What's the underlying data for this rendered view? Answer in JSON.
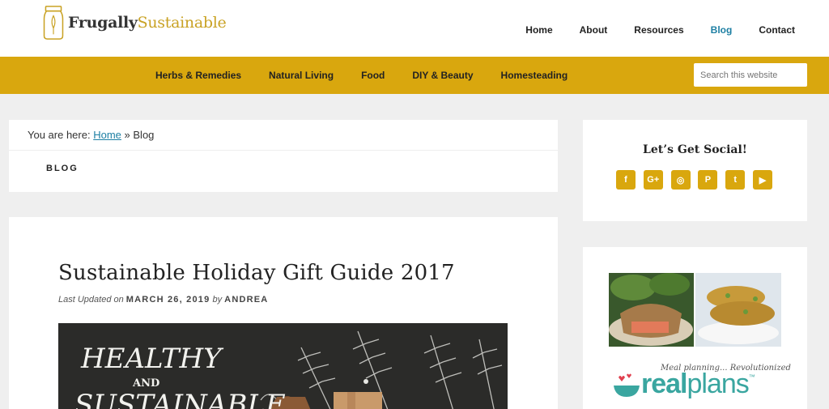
{
  "site": {
    "name_part1": "Frugally",
    "name_part2": "Sustainable"
  },
  "top_nav": [
    "Home",
    "About",
    "Resources",
    "Blog",
    "Contact"
  ],
  "top_nav_active": "Blog",
  "category_nav": [
    "Herbs & Remedies",
    "Natural Living",
    "Food",
    "DIY & Beauty",
    "Homesteading"
  ],
  "search": {
    "placeholder": "Search this website"
  },
  "breadcrumb": {
    "prefix": "You are here:",
    "home": "Home",
    "separator": "»",
    "current": "Blog"
  },
  "archive_title": "BLOG",
  "post": {
    "title": "Sustainable Holiday Gift Guide 2017",
    "updated_label": "Last Updated on",
    "date": "MARCH 26, 2019",
    "by": "by",
    "author": "ANDREA",
    "image_text_line1": "HEALTHY",
    "image_text_line2": "AND",
    "image_text_line3": "SUSTAINABLE"
  },
  "sidebar": {
    "social_title": "Let’s Get Social!",
    "social_icons": [
      "facebook-icon",
      "google-plus-icon",
      "instagram-icon",
      "pinterest-icon",
      "twitter-icon",
      "youtube-icon"
    ],
    "social_glyphs": [
      "f",
      "G+",
      "◎",
      "P",
      "t",
      "▶"
    ],
    "ad_tagline": "Meal planning... Revolutionized",
    "ad_brand_part1": "real",
    "ad_brand_part2": "plans",
    "ad_brand_tm": "™"
  },
  "colors": {
    "accent": "#d9a70e",
    "link": "#1d7fa3",
    "background": "#efefef",
    "ad_teal": "#3aa6a0"
  }
}
